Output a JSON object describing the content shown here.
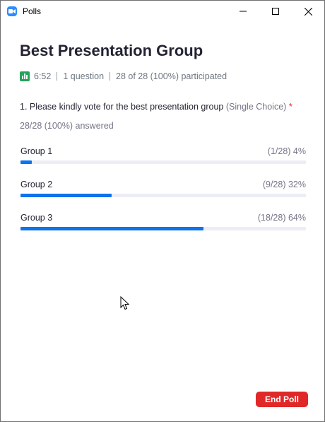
{
  "window": {
    "title": "Polls"
  },
  "poll": {
    "title": "Best Presentation Group",
    "duration": "6:52",
    "question_count": "1 question",
    "participation": "28 of 28 (100%) participated",
    "question": {
      "text": "1. Please kindly vote for the best presentation group",
      "type": "(Single Choice)",
      "required_mark": "*",
      "answered": "28/28 (100%) answered"
    },
    "options": [
      {
        "label": "Group 1",
        "stat": "(1/28) 4%",
        "percent": 4
      },
      {
        "label": "Group 2",
        "stat": "(9/28) 32%",
        "percent": 32
      },
      {
        "label": "Group 3",
        "stat": "(18/28) 64%",
        "percent": 64
      }
    ]
  },
  "footer": {
    "end_button": "End Poll"
  },
  "colors": {
    "accent": "#0e72ed",
    "danger": "#e02828",
    "poll_icon": "#23a35a",
    "app_icon": "#2d8cff"
  }
}
